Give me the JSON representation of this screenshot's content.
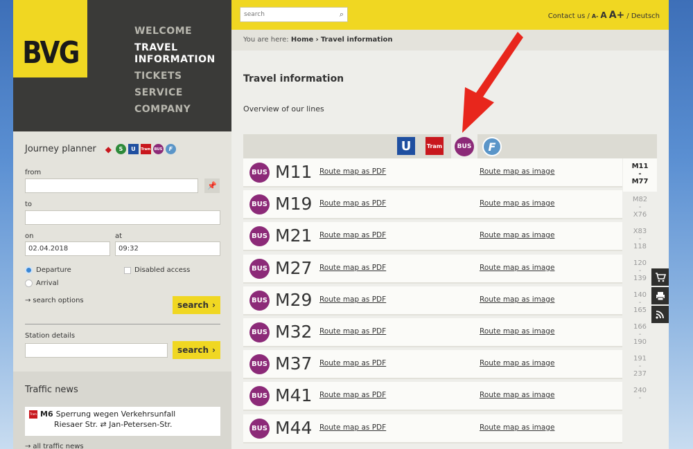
{
  "logo": {
    "text": "BVG"
  },
  "nav": [
    {
      "label": "WELCOME",
      "active": false
    },
    {
      "label": "TRAVEL INFORMATION",
      "active": true
    },
    {
      "label": "TICKETS",
      "active": false
    },
    {
      "label": "SERVICE",
      "active": false
    },
    {
      "label": "COMPANY",
      "active": false
    }
  ],
  "journey_planner": {
    "title": "Journey planner",
    "mode_icons": [
      "rail-icon",
      "s-bahn-icon",
      "u-bahn-icon",
      "tram-icon",
      "bus-icon",
      "ferry-icon"
    ],
    "from_label": "from",
    "from_value": "",
    "to_label": "to",
    "to_value": "",
    "on_label": "on",
    "on_value": "02.04.2018",
    "at_label": "at",
    "at_value": "09:32",
    "departure_label": "Departure",
    "arrival_label": "Arrival",
    "disabled_label": "Disabled access",
    "search_options": "search options",
    "search_button": "search",
    "station_label": "Station details",
    "station_value": "",
    "station_button": "search"
  },
  "traffic": {
    "title": "Traffic news",
    "item_line": "M6",
    "item_text": "Sperrung wegen Verkehrsunfall",
    "item_route": "Riesaer Str. ⇄ Jan-Petersen-Str.",
    "all_link": "all traffic news"
  },
  "topbar": {
    "search_placeholder": "search",
    "contact": "Contact us /",
    "font_small": "A-",
    "font_mid": "A",
    "font_big": "A+",
    "language": "/ Deutsch"
  },
  "breadcrumb": {
    "prefix": "You are here:",
    "home": "Home",
    "sep": "›",
    "current": "Travel information"
  },
  "content": {
    "title": "Travel information",
    "subtitle": "Overview of our lines"
  },
  "modes": {
    "u": "U",
    "tram": "Tram",
    "bus": "BUS",
    "f": "F"
  },
  "lines": [
    {
      "badge": "BUS",
      "name": "M11",
      "pdf": "Route map as PDF",
      "image": "Route map as image"
    },
    {
      "badge": "BUS",
      "name": "M19",
      "pdf": "Route map as PDF",
      "image": "Route map as image"
    },
    {
      "badge": "BUS",
      "name": "M21",
      "pdf": "Route map as PDF",
      "image": "Route map as image"
    },
    {
      "badge": "BUS",
      "name": "M27",
      "pdf": "Route map as PDF",
      "image": "Route map as image"
    },
    {
      "badge": "BUS",
      "name": "M29",
      "pdf": "Route map as PDF",
      "image": "Route map as image"
    },
    {
      "badge": "BUS",
      "name": "M32",
      "pdf": "Route map as PDF",
      "image": "Route map as image"
    },
    {
      "badge": "BUS",
      "name": "M37",
      "pdf": "Route map as PDF",
      "image": "Route map as image"
    },
    {
      "badge": "BUS",
      "name": "M41",
      "pdf": "Route map as PDF",
      "image": "Route map as image"
    },
    {
      "badge": "BUS",
      "name": "M44",
      "pdf": "Route map as PDF",
      "image": "Route map as image"
    }
  ],
  "ranges": [
    {
      "from": "M11",
      "to": "M77",
      "active": true
    },
    {
      "from": "M82",
      "to": "X76",
      "active": false
    },
    {
      "from": "X83",
      "to": "118",
      "active": false
    },
    {
      "from": "120",
      "to": "139",
      "active": false
    },
    {
      "from": "140",
      "to": "165",
      "active": false
    },
    {
      "from": "166",
      "to": "190",
      "active": false
    },
    {
      "from": "191",
      "to": "237",
      "active": false
    },
    {
      "from": "240",
      "to": "",
      "active": false
    }
  ],
  "range_sep": "-",
  "colors": {
    "yellow": "#f0d722",
    "bus": "#8c2a78",
    "dark": "#3a3a38",
    "arrow": "#e8261c"
  }
}
